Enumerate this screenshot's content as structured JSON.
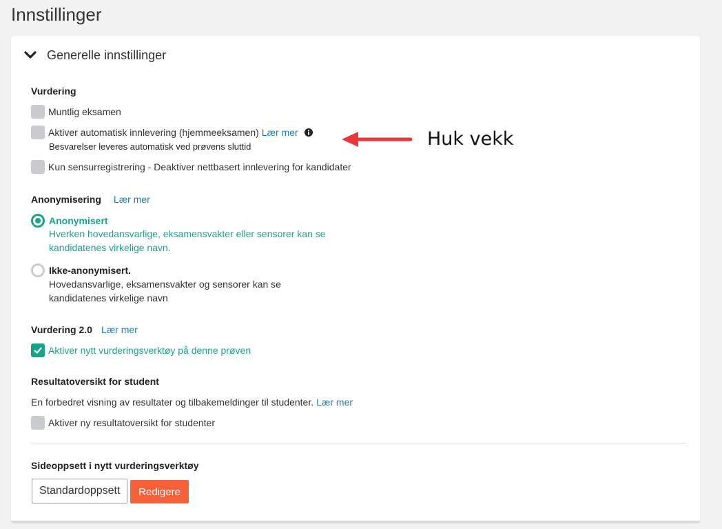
{
  "page": {
    "title": "Innstillinger"
  },
  "panel": {
    "title": "Generelle innstillinger",
    "expanded": true
  },
  "vurdering": {
    "label": "Vurdering",
    "options": [
      {
        "label": "Muntlig eksamen",
        "checked": false
      },
      {
        "label": "Aktiver automatisk innlevering (hjemmeeksamen)",
        "link": "Lær mer",
        "subtext": "Besvarelser leveres automatisk ved prøvens sluttid",
        "checked": false
      },
      {
        "label": "Kun sensurregistrering - Deaktiver nettbasert innlevering for kandidater",
        "checked": false
      }
    ]
  },
  "anonymisering": {
    "label": "Anonymisering",
    "link": "Lær mer",
    "options": [
      {
        "title": "Anonymisert",
        "desc_line1": "Hverken hovedansvarlige, eksamensvakter eller sensorer kan se",
        "desc_line2": "kandidatenes virkelige navn.",
        "selected": true
      },
      {
        "title": "Ikke-anonymisert.",
        "desc_line1": "Hovedansvarlige, eksamensvakter og sensorer kan se",
        "desc_line2": "kandidatenes virkelige navn",
        "selected": false
      }
    ]
  },
  "vurdering2": {
    "label": "Vurdering 2.0",
    "link": "Lær mer",
    "option": {
      "label": "Aktiver nytt vurderingsverktøy på denne prøven",
      "checked": true
    }
  },
  "resultatoversikt": {
    "label": "Resultatoversikt for student",
    "desc": "En forbedret visning av resultater og tilbakemeldinger til studenter.",
    "link": "Lær mer",
    "option": {
      "label": "Aktiver ny resultatoversikt for studenter",
      "checked": false
    }
  },
  "sideoppsett": {
    "label": "Sideoppsett i nytt vurderingsverktøy",
    "select_value": "Standardoppsett",
    "edit_button": "Redigere"
  },
  "annotation": {
    "text": "Huk vekk",
    "arrow_color": "#e8383d"
  },
  "colors": {
    "accent": "#1aa38b",
    "link": "#1a7fb3",
    "button": "#f5623a"
  }
}
